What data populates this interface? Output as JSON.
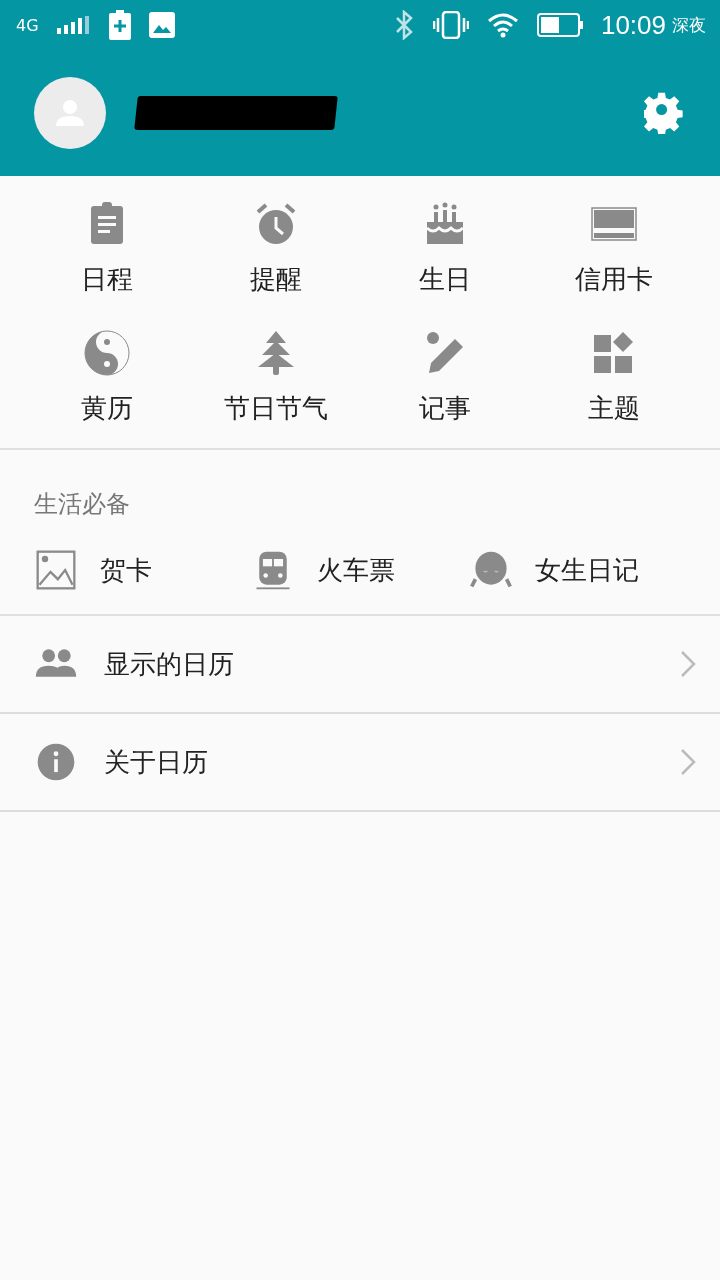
{
  "status_bar": {
    "network": "4G",
    "time": "10:09",
    "mode": "深夜"
  },
  "header": {
    "name_redacted": true
  },
  "shortcuts": [
    {
      "kind": "schedule",
      "label": "日程"
    },
    {
      "kind": "alarm",
      "label": "提醒"
    },
    {
      "kind": "cake",
      "label": "生日"
    },
    {
      "kind": "card",
      "label": "信用卡"
    },
    {
      "kind": "yinyang",
      "label": "黄历"
    },
    {
      "kind": "tree",
      "label": "节日节气"
    },
    {
      "kind": "note",
      "label": "记事"
    },
    {
      "kind": "theme",
      "label": "主题"
    }
  ],
  "essentials": {
    "title": "生活必备",
    "items": [
      {
        "kind": "image",
        "label": "贺卡"
      },
      {
        "kind": "train",
        "label": "火车票"
      },
      {
        "kind": "girl",
        "label": "女生日记"
      }
    ]
  },
  "menu": [
    {
      "kind": "people",
      "label": "显示的日历"
    },
    {
      "kind": "info",
      "label": "关于日历"
    }
  ]
}
